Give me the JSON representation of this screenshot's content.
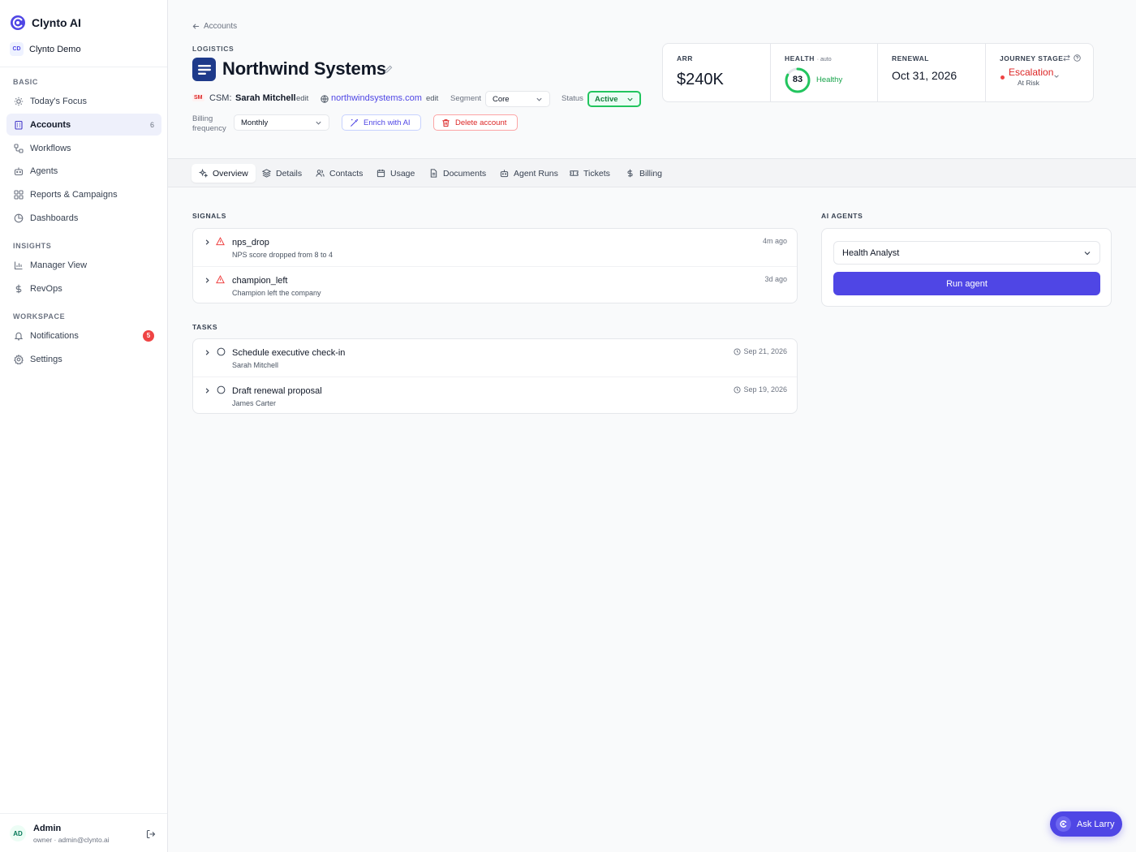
{
  "brand": {
    "name": "Clynto AI",
    "logo_icon": "clynto-logo-icon"
  },
  "org": {
    "initials": "CD",
    "name": "Clynto Demo"
  },
  "sidebar": {
    "sections": [
      {
        "label": "BASIC"
      },
      {
        "label": "INSIGHTS"
      },
      {
        "label": "WORKSPACE"
      }
    ],
    "items": [
      {
        "label": "Today's Focus",
        "icon": "sun-icon"
      },
      {
        "label": "Accounts",
        "icon": "building-icon",
        "count": "6",
        "active": true
      },
      {
        "label": "Workflows",
        "icon": "workflow-icon"
      },
      {
        "label": "Agents",
        "icon": "bot-icon"
      },
      {
        "label": "Reports & Campaigns",
        "icon": "grid-icon"
      },
      {
        "label": "Dashboards",
        "icon": "pie-chart-icon"
      },
      {
        "label": "Manager View",
        "icon": "bar-chart-icon"
      },
      {
        "label": "RevOps",
        "icon": "dollar-icon"
      },
      {
        "label": "Notifications",
        "icon": "bell-icon",
        "badge": "5"
      },
      {
        "label": "Settings",
        "icon": "gear-icon"
      }
    ]
  },
  "user": {
    "initials": "AD",
    "name": "Admin",
    "meta": "owner · admin@clynto.ai"
  },
  "header": {
    "back_label": "Accounts",
    "industry": "LOGISTICS",
    "title": "Northwind Systems",
    "csm_badge": "SM",
    "csm_label": "CSM:",
    "csm_name": "Sarah Mitchell",
    "edit_label": "edit",
    "website": "northwindsystems.com",
    "segment_label": "Segment",
    "segment_value": "Core",
    "status_label": "Status",
    "status_value": "Active",
    "billing_label": "Billing frequency",
    "billing_value": "Monthly",
    "enrich_label": "Enrich with AI",
    "delete_label": "Delete account"
  },
  "stats": {
    "arr_label": "ARR",
    "arr_value": "$240K",
    "health_label": "HEALTH",
    "health_sub": "· auto",
    "health_score": "83",
    "health_score_fraction": 0.83,
    "health_status": "Healthy",
    "renewal_label": "RENEWAL",
    "renewal_value": "Oct 31, 2026",
    "journey_label": "JOURNEY STAGE",
    "journey_value": "Escalation",
    "journey_sub": "At Risk"
  },
  "tabs": [
    {
      "label": "Overview",
      "icon": "sparkle-icon",
      "active": true
    },
    {
      "label": "Details",
      "icon": "layers-icon"
    },
    {
      "label": "Contacts",
      "icon": "users-icon"
    },
    {
      "label": "Usage",
      "icon": "calendar-icon"
    },
    {
      "label": "Documents",
      "icon": "document-icon"
    },
    {
      "label": "Agent Runs",
      "icon": "bot-icon"
    },
    {
      "label": "Tickets",
      "icon": "ticket-icon"
    },
    {
      "label": "Billing",
      "icon": "dollar-icon"
    }
  ],
  "signals": {
    "heading": "SIGNALS",
    "items": [
      {
        "title": "nps_drop",
        "desc": "NPS score dropped from 8 to 4",
        "time": "4m ago"
      },
      {
        "title": "champion_left",
        "desc": "Champion left the company",
        "time": "3d ago"
      }
    ]
  },
  "tasks": {
    "heading": "TASKS",
    "items": [
      {
        "title": "Schedule executive check-in",
        "owner": "Sarah Mitchell",
        "due": "Sep 21, 2026"
      },
      {
        "title": "Draft renewal proposal",
        "owner": "James Carter",
        "due": "Sep 19, 2026"
      }
    ]
  },
  "agents": {
    "heading": "AI AGENTS",
    "selected": "Health Analyst",
    "run_label": "Run agent"
  },
  "ask": {
    "label": "Ask Larry"
  },
  "colors": {
    "accent": "#4f46e5",
    "success": "#22c55e",
    "danger": "#ef4444"
  }
}
